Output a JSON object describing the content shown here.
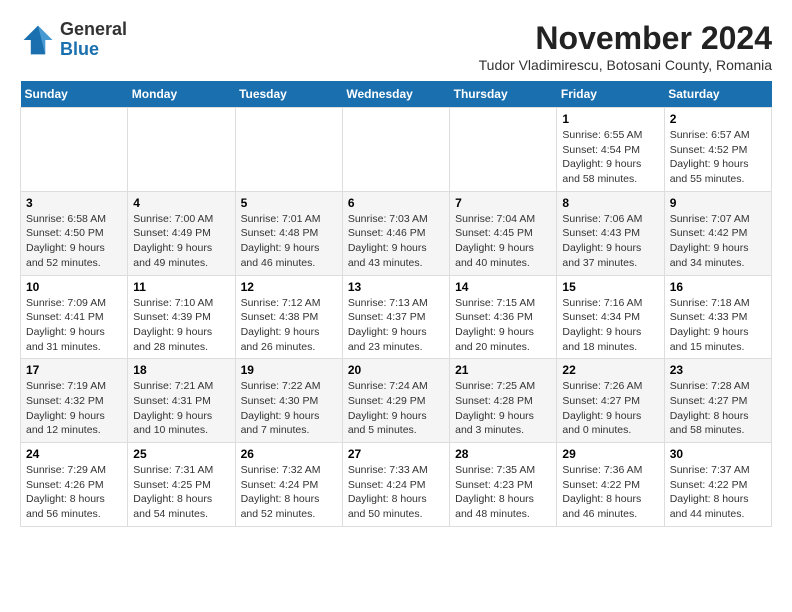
{
  "logo": {
    "general": "General",
    "blue": "Blue"
  },
  "header": {
    "month_year": "November 2024",
    "location": "Tudor Vladimirescu, Botosani County, Romania"
  },
  "weekdays": [
    "Sunday",
    "Monday",
    "Tuesday",
    "Wednesday",
    "Thursday",
    "Friday",
    "Saturday"
  ],
  "weeks": [
    [
      {
        "day": "",
        "info": ""
      },
      {
        "day": "",
        "info": ""
      },
      {
        "day": "",
        "info": ""
      },
      {
        "day": "",
        "info": ""
      },
      {
        "day": "",
        "info": ""
      },
      {
        "day": "1",
        "info": "Sunrise: 6:55 AM\nSunset: 4:54 PM\nDaylight: 9 hours and 58 minutes."
      },
      {
        "day": "2",
        "info": "Sunrise: 6:57 AM\nSunset: 4:52 PM\nDaylight: 9 hours and 55 minutes."
      }
    ],
    [
      {
        "day": "3",
        "info": "Sunrise: 6:58 AM\nSunset: 4:50 PM\nDaylight: 9 hours and 52 minutes."
      },
      {
        "day": "4",
        "info": "Sunrise: 7:00 AM\nSunset: 4:49 PM\nDaylight: 9 hours and 49 minutes."
      },
      {
        "day": "5",
        "info": "Sunrise: 7:01 AM\nSunset: 4:48 PM\nDaylight: 9 hours and 46 minutes."
      },
      {
        "day": "6",
        "info": "Sunrise: 7:03 AM\nSunset: 4:46 PM\nDaylight: 9 hours and 43 minutes."
      },
      {
        "day": "7",
        "info": "Sunrise: 7:04 AM\nSunset: 4:45 PM\nDaylight: 9 hours and 40 minutes."
      },
      {
        "day": "8",
        "info": "Sunrise: 7:06 AM\nSunset: 4:43 PM\nDaylight: 9 hours and 37 minutes."
      },
      {
        "day": "9",
        "info": "Sunrise: 7:07 AM\nSunset: 4:42 PM\nDaylight: 9 hours and 34 minutes."
      }
    ],
    [
      {
        "day": "10",
        "info": "Sunrise: 7:09 AM\nSunset: 4:41 PM\nDaylight: 9 hours and 31 minutes."
      },
      {
        "day": "11",
        "info": "Sunrise: 7:10 AM\nSunset: 4:39 PM\nDaylight: 9 hours and 28 minutes."
      },
      {
        "day": "12",
        "info": "Sunrise: 7:12 AM\nSunset: 4:38 PM\nDaylight: 9 hours and 26 minutes."
      },
      {
        "day": "13",
        "info": "Sunrise: 7:13 AM\nSunset: 4:37 PM\nDaylight: 9 hours and 23 minutes."
      },
      {
        "day": "14",
        "info": "Sunrise: 7:15 AM\nSunset: 4:36 PM\nDaylight: 9 hours and 20 minutes."
      },
      {
        "day": "15",
        "info": "Sunrise: 7:16 AM\nSunset: 4:34 PM\nDaylight: 9 hours and 18 minutes."
      },
      {
        "day": "16",
        "info": "Sunrise: 7:18 AM\nSunset: 4:33 PM\nDaylight: 9 hours and 15 minutes."
      }
    ],
    [
      {
        "day": "17",
        "info": "Sunrise: 7:19 AM\nSunset: 4:32 PM\nDaylight: 9 hours and 12 minutes."
      },
      {
        "day": "18",
        "info": "Sunrise: 7:21 AM\nSunset: 4:31 PM\nDaylight: 9 hours and 10 minutes."
      },
      {
        "day": "19",
        "info": "Sunrise: 7:22 AM\nSunset: 4:30 PM\nDaylight: 9 hours and 7 minutes."
      },
      {
        "day": "20",
        "info": "Sunrise: 7:24 AM\nSunset: 4:29 PM\nDaylight: 9 hours and 5 minutes."
      },
      {
        "day": "21",
        "info": "Sunrise: 7:25 AM\nSunset: 4:28 PM\nDaylight: 9 hours and 3 minutes."
      },
      {
        "day": "22",
        "info": "Sunrise: 7:26 AM\nSunset: 4:27 PM\nDaylight: 9 hours and 0 minutes."
      },
      {
        "day": "23",
        "info": "Sunrise: 7:28 AM\nSunset: 4:27 PM\nDaylight: 8 hours and 58 minutes."
      }
    ],
    [
      {
        "day": "24",
        "info": "Sunrise: 7:29 AM\nSunset: 4:26 PM\nDaylight: 8 hours and 56 minutes."
      },
      {
        "day": "25",
        "info": "Sunrise: 7:31 AM\nSunset: 4:25 PM\nDaylight: 8 hours and 54 minutes."
      },
      {
        "day": "26",
        "info": "Sunrise: 7:32 AM\nSunset: 4:24 PM\nDaylight: 8 hours and 52 minutes."
      },
      {
        "day": "27",
        "info": "Sunrise: 7:33 AM\nSunset: 4:24 PM\nDaylight: 8 hours and 50 minutes."
      },
      {
        "day": "28",
        "info": "Sunrise: 7:35 AM\nSunset: 4:23 PM\nDaylight: 8 hours and 48 minutes."
      },
      {
        "day": "29",
        "info": "Sunrise: 7:36 AM\nSunset: 4:22 PM\nDaylight: 8 hours and 46 minutes."
      },
      {
        "day": "30",
        "info": "Sunrise: 7:37 AM\nSunset: 4:22 PM\nDaylight: 8 hours and 44 minutes."
      }
    ]
  ]
}
